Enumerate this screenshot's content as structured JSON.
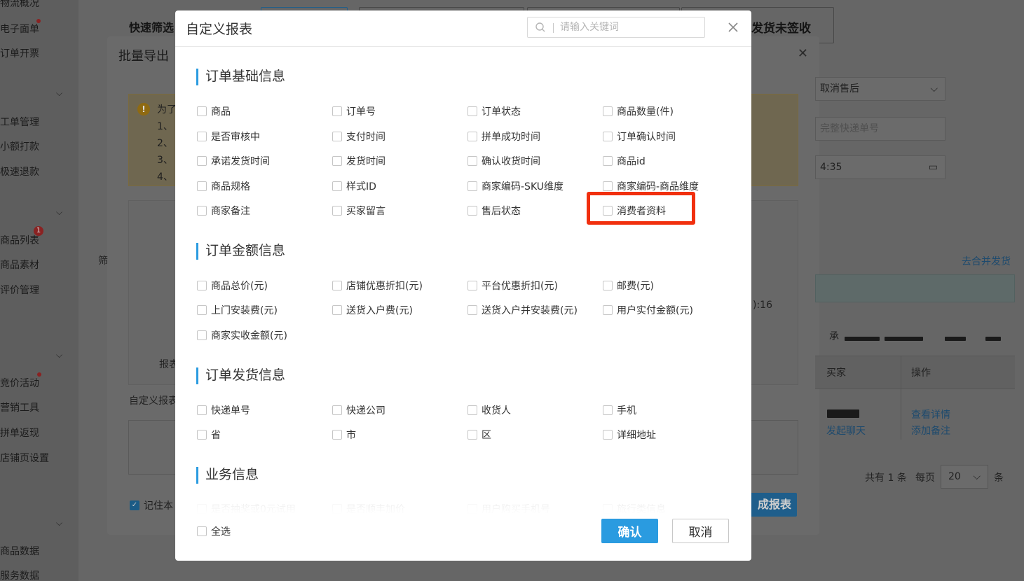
{
  "background": {
    "sidebar_items": [
      "物流概况",
      "电子面单",
      "订单开票",
      "工单管理",
      "小额打款",
      "极速退款",
      "商品列表",
      "商品素材",
      "评价管理",
      "竞价活动",
      "营销工具",
      "拼单返现",
      "店铺页设置",
      "商品数据",
      "服务数据"
    ],
    "sidebar_badge": "1",
    "quick_filter_label": "快速筛选",
    "tab_right_label": "发货未签收",
    "panel_title": "批量导出",
    "warning_lines": [
      "为了",
      "1、",
      "2、",
      "3、",
      "4、"
    ],
    "labels": {
      "filter": "筛",
      "report": "报表",
      "custom_report": "自定义报表",
      "remember": "记住本"
    },
    "generate_button": "成报表",
    "right_fields": {
      "after_sale": "取消售后",
      "tracking_placeholder": "完整快递单号",
      "time": "4:35"
    },
    "right_texts": {
      "merge_ship": "去合并发货",
      "time_fragment": "):16",
      "promise_prefix": "承",
      "buyer": "买家",
      "operation": "操作",
      "view_details": "查看详情",
      "add_note": "添加备注",
      "start_chat": "发起聊天",
      "total": "共有 1 条",
      "per_page": "每页",
      "page_size": "20",
      "page_unit": "条"
    }
  },
  "modal": {
    "title": "自定义报表",
    "search_placeholder": "请输入关键词",
    "sections": [
      {
        "title": "订单基础信息",
        "items": [
          "商品",
          "订单号",
          "订单状态",
          "商品数量(件)",
          "是否审核中",
          "支付时间",
          "拼单成功时间",
          "订单确认时间",
          "承诺发货时间",
          "发货时间",
          "确认收货时间",
          "商品id",
          "商品规格",
          "样式ID",
          "商家编码-SKU维度",
          "商家编码-商品维度",
          "商家备注",
          "买家留言",
          "售后状态",
          "消费者资料"
        ]
      },
      {
        "title": "订单金额信息",
        "items": [
          "商品总价(元)",
          "店铺优惠折扣(元)",
          "平台优惠折扣(元)",
          "邮费(元)",
          "上门安装费(元)",
          "送货入户费(元)",
          "送货入户并安装费(元)",
          "用户实付金额(元)",
          "商家实收金额(元)"
        ]
      },
      {
        "title": "订单发货信息",
        "items": [
          "快递单号",
          "快递公司",
          "收货人",
          "手机",
          "省",
          "市",
          "区",
          "详细地址"
        ]
      },
      {
        "title": "业务信息",
        "items": [
          "是否抽奖或0元试用",
          "是否顺丰加价",
          "用户购买手机号",
          "旅行类信息"
        ]
      }
    ],
    "select_all_label": "全选",
    "confirm_label": "确认",
    "cancel_label": "取消",
    "highlighted_item": "消费者资料",
    "colors": {
      "accent": "#2a9be0",
      "highlight": "#f12f0e"
    }
  }
}
